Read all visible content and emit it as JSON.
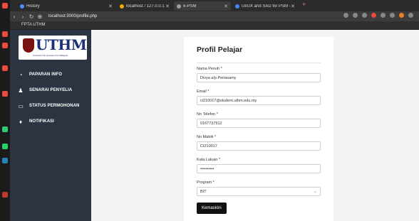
{
  "browser": {
    "tabs": [
      {
        "label": "History",
        "color": "#4f8ef7"
      },
      {
        "label": "localhost / 127.0.0.1 / spm",
        "color": "#f7a600"
      },
      {
        "label": "e-PSM",
        "color": "#9aa0a6"
      },
      {
        "label": "UI/UX and SAD for PSM - Go",
        "color": "#4285f4"
      }
    ],
    "url": "localhost:3000/profile.php",
    "bookmark": "FPTA UTHM"
  },
  "sidebar": {
    "logo_text": "UTHM",
    "logo_sub": "Universiti Tun Hussein Onn Malaysia",
    "items": [
      {
        "label": "PAPARAN INFO",
        "icon": "dashboard-icon",
        "glyph": "◔"
      },
      {
        "label": "SENARAI PENYELIA",
        "icon": "user-icon",
        "glyph": "♟"
      },
      {
        "label": "STATUS PERMOHONAN",
        "icon": "status-icon",
        "glyph": "▭"
      },
      {
        "label": "NOTIFIKASI",
        "icon": "bell-icon",
        "glyph": "♦"
      }
    ]
  },
  "profile": {
    "title": "Profil Pelajar",
    "fields": [
      {
        "label": "Nama Penuh *",
        "value": "Divya a/p Periasamy"
      },
      {
        "label": "Email *",
        "value": "ci210017@student.uthm.edu.my"
      },
      {
        "label": "No Telefon *",
        "value": "0167737912"
      },
      {
        "label": "No Matrik *",
        "value": "CI210017"
      },
      {
        "label": "Kata Laluan *",
        "value": "••••••••••"
      },
      {
        "label": "Program *",
        "value": "BIT"
      }
    ],
    "submit_label": "Kemaskini"
  }
}
